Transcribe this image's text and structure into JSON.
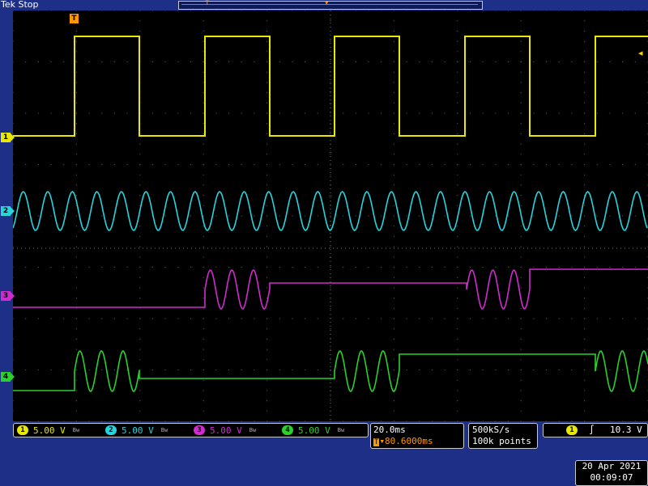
{
  "header": {
    "brand": "Tek Stop",
    "record_trigger_marker": "T"
  },
  "screen": {
    "trigger_marker": "T",
    "trigger_level_arrow": "◂",
    "channel_markers": [
      "1",
      "2",
      "3",
      "4"
    ],
    "colors": {
      "ch1": "#e8e800",
      "ch2": "#27d3dd",
      "ch3": "#d02bd0",
      "ch4": "#2ad12a",
      "trigger": "#ff9800",
      "grid": "#5a5a5a"
    }
  },
  "channels": [
    {
      "id": "1",
      "scale": "5.00 V",
      "bw": "Bw"
    },
    {
      "id": "2",
      "scale": "5.00 V",
      "bw": "Bw"
    },
    {
      "id": "3",
      "scale": "5.00 V",
      "bw": "Bw"
    },
    {
      "id": "4",
      "scale": "5.00 V",
      "bw": "Bw"
    }
  ],
  "timebase": {
    "per_div": "20.0ms",
    "trigger_pos": "▾80.6000ms",
    "trigger_prefix": "T"
  },
  "acquisition": {
    "sample_rate": "500kS/s",
    "record_length": "100k points"
  },
  "trigger": {
    "source": "1",
    "slope_icon": "rising-edge-icon",
    "slope_glyph": "∫",
    "level": "10.3 V"
  },
  "datetime": {
    "date": "20 Apr  2021",
    "time": "00:09:07"
  }
}
